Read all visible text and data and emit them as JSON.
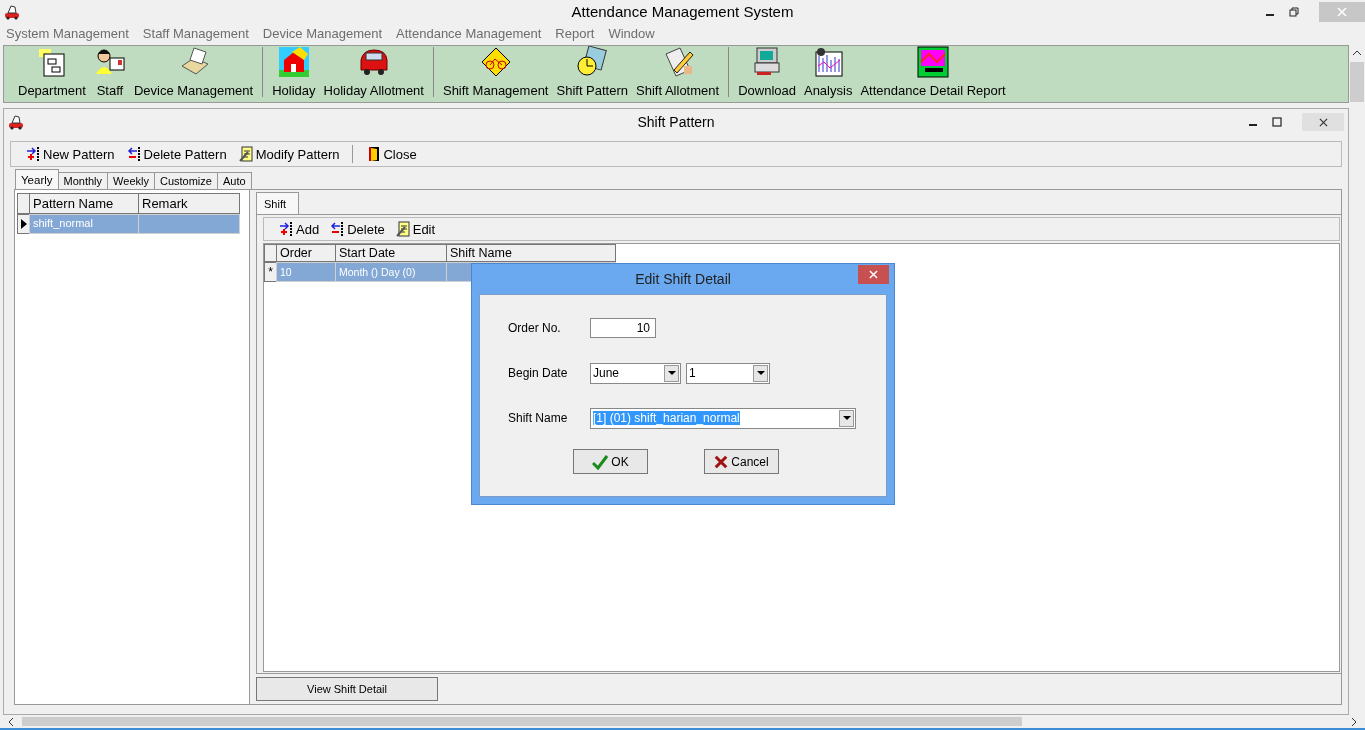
{
  "window": {
    "title": "Attendance Management System"
  },
  "menu": [
    "System Management",
    "Staff Management",
    "Device Management",
    "Attendance Management",
    "Report",
    "Window"
  ],
  "toolbar": [
    [
      "Department",
      "Staff",
      "Device Management"
    ],
    [
      "Holiday",
      "Holiday Allotment"
    ],
    [
      "Shift Management",
      "Shift Pattern",
      "Shift Allotment"
    ],
    [
      "Download",
      "Analysis",
      "Attendance Detail Report"
    ]
  ],
  "child_window": {
    "title": "Shift Pattern",
    "toolbar": [
      "New Pattern",
      "Delete Pattern",
      "Modify Pattern",
      "Close"
    ],
    "tabs": [
      {
        "label": "Yearly",
        "selected": true
      },
      {
        "label": "Monthly",
        "selected": false
      },
      {
        "label": "Weekly",
        "selected": false
      },
      {
        "label": "Customize",
        "selected": false
      },
      {
        "label": "Auto",
        "selected": false
      }
    ],
    "pattern_table": {
      "columns": [
        "Pattern Name",
        "Remark"
      ],
      "rows": [
        {
          "cells": [
            "shift_normal",
            ""
          ],
          "selected": true
        }
      ]
    },
    "detail_tabs": [
      {
        "label": "Shift",
        "selected": true
      }
    ],
    "detail_toolbar": [
      "Add",
      "Delete",
      "Edit"
    ],
    "shift_table": {
      "columns": [
        "Order",
        "Start Date",
        "Shift Name"
      ],
      "rows": [
        {
          "marker": "*",
          "cells": [
            "10",
            "Month () Day (0)",
            ""
          ],
          "selected": true
        }
      ]
    },
    "view_button": "View Shift Detail"
  },
  "dialog": {
    "title": "Edit Shift Detail",
    "order_label": "Order No.",
    "order_value": "10",
    "date_label": "Begin Date",
    "month": "June",
    "day": "1",
    "shift_label": "Shift Name",
    "shift_value": "[1] (01) shift_harian_normal",
    "ok": "OK",
    "cancel": "Cancel"
  }
}
